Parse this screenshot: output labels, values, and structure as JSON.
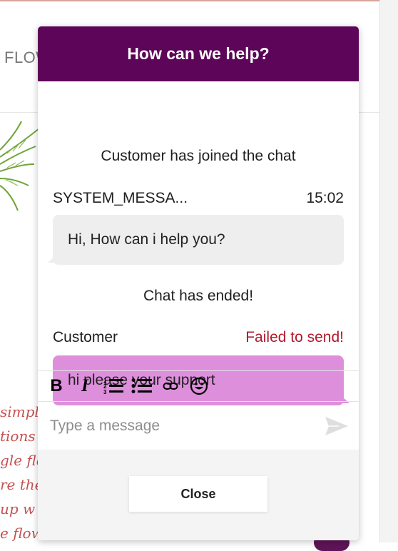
{
  "background": {
    "nav_text": "FLOW",
    "script_lines": [
      "simple",
      "tions a",
      "gle flo",
      "re the",
      "up w",
      "e flowers you send"
    ]
  },
  "chat": {
    "title": "How can we help?",
    "messages": [
      {
        "type": "system",
        "text": "Customer has joined the chat"
      },
      {
        "type": "agent",
        "sender": "SYSTEM_MESSA...",
        "time": "15:02",
        "text": "Hi, How can i help you?"
      },
      {
        "type": "system",
        "text": "Chat has ended!"
      },
      {
        "type": "customer",
        "sender": "Customer",
        "status": "Failed to send!",
        "text": "hi please your support"
      }
    ],
    "composer": {
      "placeholder": "Type a message"
    },
    "toolbar": [
      "bold",
      "italic",
      "ordered-list",
      "unordered-list",
      "link",
      "emoji"
    ],
    "close_label": "Close"
  },
  "colors": {
    "header_bg": "#5d0558",
    "customer_bubble": "#de8fdc",
    "agent_bubble": "#eeeeee",
    "error_text": "#b0192e"
  }
}
